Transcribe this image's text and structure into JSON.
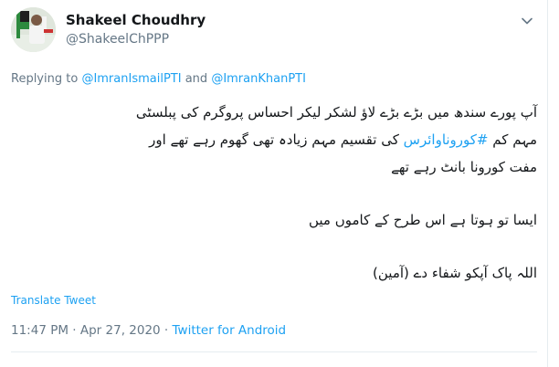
{
  "author": {
    "display_name": "Shakeel Choudhry",
    "handle": "@ShakeelChPPP"
  },
  "reply": {
    "prefix": "Replying to",
    "mention_1": "@ImranIsmailPTI",
    "and": "and",
    "mention_2": "@ImranKhanPTI"
  },
  "tweet": {
    "line_1": "آپ پورے سندھ میں بڑے بڑے لاؤ لشکر لیکر احساس پروگرم کی پبلسٹی",
    "line_2_before": "مہم کم",
    "hashtag": "#کوروناوائرس",
    "line_2_after": "کی تقسیم مہم زیادہ تھی گھوم رہے تھے اور",
    "line_3": "مفت کورونا بانٹ رہے تھے",
    "line_4": "ایسا تو ہوتا ہے اس طرح کے کاموں میں",
    "line_5": "اللہ پاک آپکو شفاء دے (آمین)"
  },
  "translate_label": "Translate Tweet",
  "meta": {
    "time": "11:47 PM",
    "separator_1": " · ",
    "date": "Apr 27, 2020",
    "separator_2": " · ",
    "client": "Twitter for Android"
  },
  "colors": {
    "link": "#1da1f2",
    "secondary_text": "#657786",
    "primary_text": "#14171a",
    "border": "#e6ecf0"
  },
  "icons": {
    "menu": "chevron-down-icon"
  }
}
